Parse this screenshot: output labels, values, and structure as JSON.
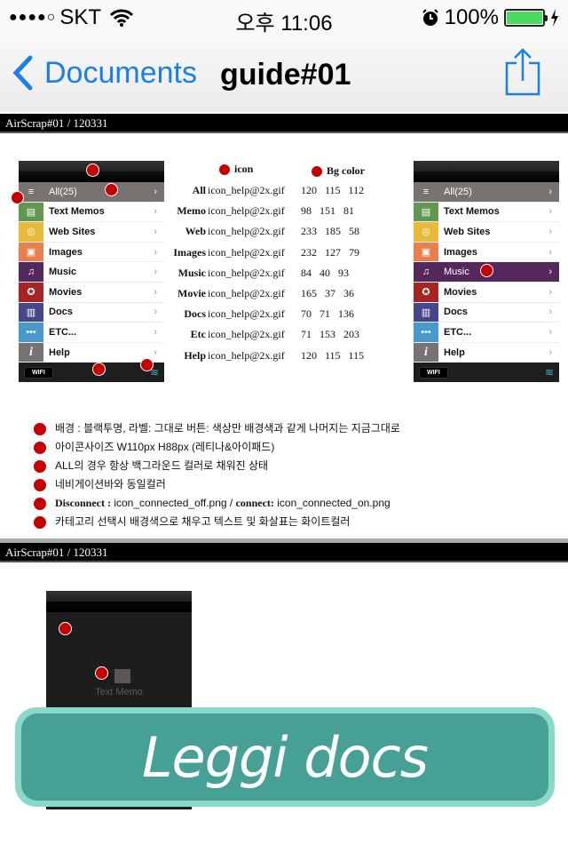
{
  "status_bar": {
    "signal": "●●●●○",
    "carrier": "SKT",
    "time": "오후 11:06",
    "battery_percent": "100%",
    "battery_level": 1.0,
    "battery_color": "#4cd964"
  },
  "navbar": {
    "back_label": "Documents",
    "title": "guide#01",
    "accent": "#1a7fe8"
  },
  "document": {
    "header_1": "AirScrap#01  / 120331",
    "header_2": "AirScrap#01  / 120331",
    "menu": {
      "items": [
        {
          "label": "All(25)",
          "icon": "list-icon",
          "color": "#787370"
        },
        {
          "label": "Text Memos",
          "icon": "memo-icon",
          "color": "#629751"
        },
        {
          "label": "Web Sites",
          "icon": "compass-icon",
          "color": "#e9b93a"
        },
        {
          "label": "Images",
          "icon": "image-icon",
          "color": "#e87f4f"
        },
        {
          "label": "Music",
          "icon": "music-note-icon",
          "color": "#54285d"
        },
        {
          "label": "Movies",
          "icon": "film-reel-icon",
          "color": "#a52524"
        },
        {
          "label": "Docs",
          "icon": "document-icon",
          "color": "#464788"
        },
        {
          "label": "ETC...",
          "icon": "more-dots-icon",
          "color": "#4799cb"
        },
        {
          "label": "Help",
          "icon": "info-icon",
          "color": "#787373"
        }
      ],
      "wifi_label": "WIFI",
      "chevron": "›"
    },
    "table": {
      "header_icon": "icon",
      "header_bg": "Bg color",
      "rows": [
        {
          "category": "All",
          "file": "icon_help@2x.gif",
          "rgb": "120 115 112"
        },
        {
          "category": "Memo",
          "file": "icon_help@2x.gif",
          "rgb": "98 151 81"
        },
        {
          "category": "Web",
          "file": "icon_help@2x.gif",
          "rgb": "233 185 58"
        },
        {
          "category": "Images",
          "file": "icon_help@2x.gif",
          "rgb": "232 127 79"
        },
        {
          "category": "Music",
          "file": "icon_help@2x.gif",
          "rgb": "84 40 93"
        },
        {
          "category": "Movie",
          "file": "icon_help@2x.gif",
          "rgb": "165 37 36"
        },
        {
          "category": "Docs",
          "file": "icon_help@2x.gif",
          "rgb": "70 71 136"
        },
        {
          "category": "Etc",
          "file": "icon_help@2x.gif",
          "rgb": "71 153 203"
        },
        {
          "category": "Help",
          "file": "icon_help@2x.gif",
          "rgb": "120 115 115"
        }
      ]
    },
    "notes": [
      "배경 : 블랙투명, 라벨: 그대로  버튼: 색상만 배경색과 같게 나머지는 지금그대로",
      "아이콘사이즈 W110px   H88px (레티나&아이패드)",
      "ALL의 경우 항상 백그라운드 컬러로 채워진 상태",
      "네비게이션바와 동일컬러",
      {
        "bold1": "Disconnect :",
        "text1": " icon_connected_off.png / ",
        "bold2": "connect:",
        "text2": " icon_connected_on.png"
      },
      "카테고리 선택시 배경색으로 채우고 텍스트 및 화살표는 화이트컬러"
    ],
    "preview": {
      "label": "Text Memo"
    }
  },
  "cta": {
    "label": "Leggi docs",
    "outer_color": "#8ad9c8",
    "inner_color": "#46a096"
  }
}
